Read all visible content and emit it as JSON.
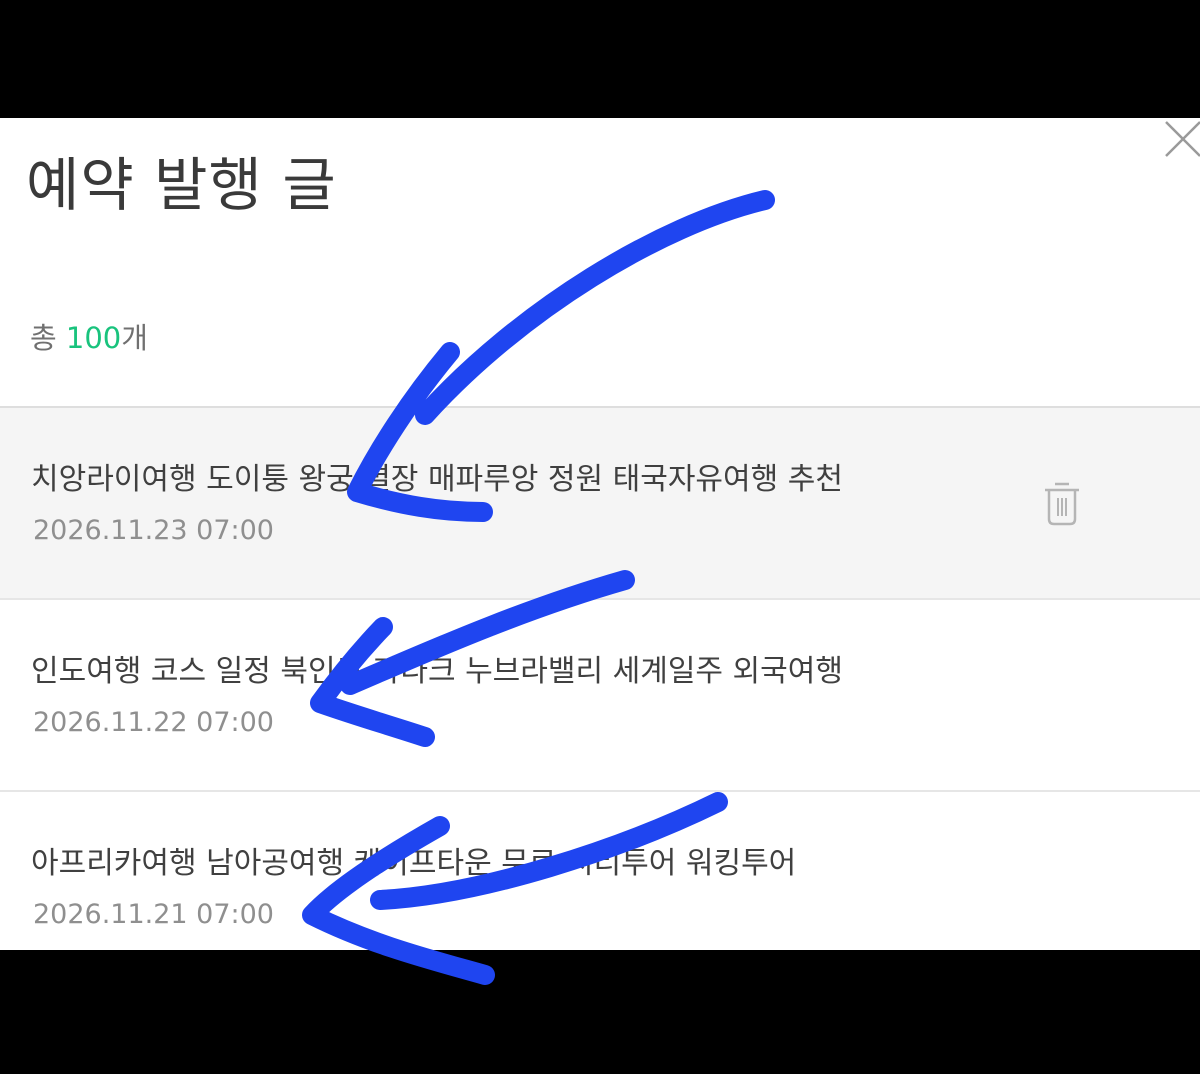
{
  "dialog": {
    "title": "예약 발행 글",
    "count_prefix": "총 ",
    "count_value": "100",
    "count_suffix": "개",
    "count_color": "#19c37d",
    "close_icon": "close-icon"
  },
  "posts": [
    {
      "title": "치앙라이여행 도이퉁 왕궁 별장 매파루앙 정원 태국자유여행 추천",
      "datetime": "2026.11.23 07:00",
      "selected": true,
      "action_icon": "trash-icon"
    },
    {
      "title": "인도여행 코스 일정 북인도 라다크 누브라밸리 세계일주 외국여행",
      "datetime": "2026.11.22 07:00",
      "selected": false
    },
    {
      "title": "아프리카여행 남아공여행 케이프타운 무료 시티투어 워킹투어",
      "datetime": "2026.11.21 07:00",
      "selected": false
    }
  ],
  "annotation": {
    "arrow_color": "#1f45f0",
    "arrow_count": 3
  }
}
